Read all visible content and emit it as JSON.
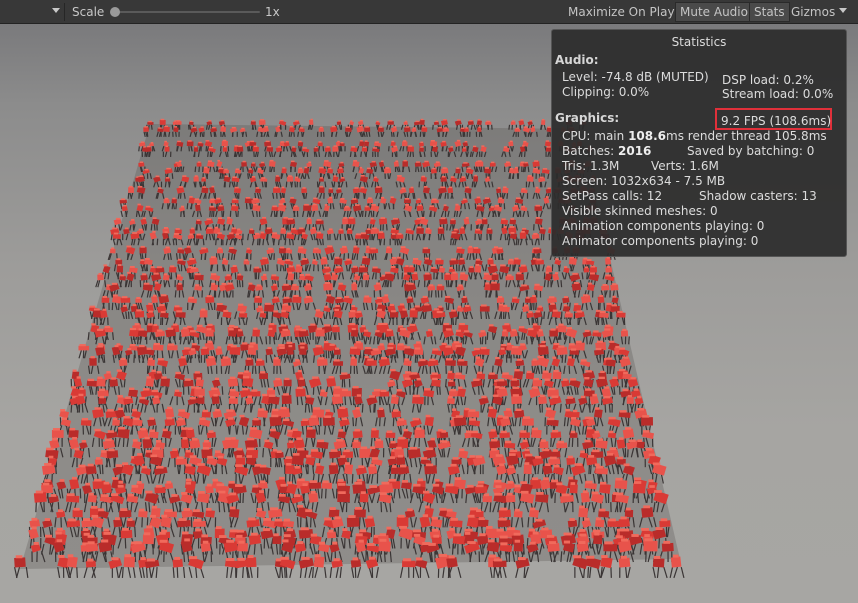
{
  "toolbar": {
    "scale_label": "Scale",
    "scale_value": "1x",
    "scale_slider_fraction": 0.0,
    "buttons": {
      "maximize_on_play": "Maximize On Play",
      "mute_audio": "Mute Audio",
      "stats": "Stats",
      "gizmos": "Gizmos"
    }
  },
  "stats": {
    "title": "Statistics",
    "audio": {
      "heading": "Audio:",
      "level": "Level: -74.8 dB (MUTED)",
      "clipping": "Clipping: 0.0%",
      "dsp_load": "DSP load: 0.2%",
      "stream_load": "Stream load: 0.0%"
    },
    "graphics": {
      "heading": "Graphics:",
      "fps": "9.2 FPS (108.6ms)",
      "cpu_prefix": "CPU: main ",
      "cpu_main": "108.6",
      "cpu_suffix": "ms  render thread 105.8ms",
      "batches_prefix": "Batches: ",
      "batches": "2016",
      "saved_by_batching": "Saved by batching: 0",
      "tris": "Tris: 1.3M",
      "verts": "Verts: 1.6M",
      "screen": "Screen: 1032x634 - 7.5 MB",
      "setpass": "SetPass calls: 12",
      "shadow_casters": "Shadow casters: 13",
      "visible_skinned": "Visible skinned meshes: 0",
      "animation_components": "Animation components playing: 0",
      "animator_components": "Animator components playing: 0"
    }
  },
  "colors": {
    "highlight": "#e0303a",
    "object_red": "#d93a35",
    "object_dark": "#3a3535"
  }
}
